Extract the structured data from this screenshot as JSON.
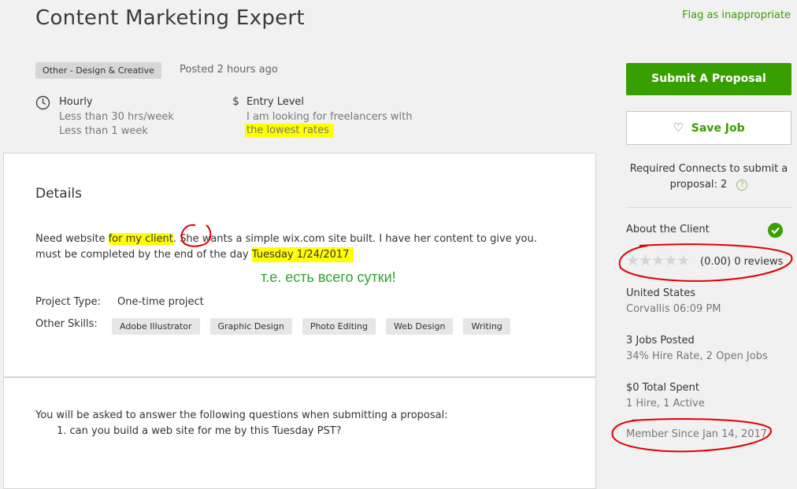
{
  "header": {
    "title": "Content Marketing Expert",
    "flag_label": "Flag as inappropriate"
  },
  "meta": {
    "category": "Other - Design & Creative",
    "posted": "Posted 2 hours ago",
    "hourly_title": "Hourly",
    "hourly_sub1": "Less than 30 hrs/week",
    "hourly_sub2": "Less than 1 week",
    "level_symbol": "$",
    "level_title": "Entry Level",
    "level_sub1": "I am looking for freelancers with",
    "level_sub2": "the lowest rates"
  },
  "details": {
    "heading": "Details",
    "desc_part1": "Need website ",
    "desc_hl1": "for my client",
    "desc_part2": ". She wants a simple wix.com site built. I have her content to give you.",
    "desc_line2": "must be completed by the end of the day ",
    "desc_hl2": "Tuesday 1/24/2017",
    "annotation": "т.е. есть всего сутки!",
    "project_type_label": "Project Type:",
    "project_type_value": "One-time project",
    "skills_label": "Other Skills:",
    "skills": [
      "Adobe Illustrator",
      "Graphic Design",
      "Photo Editing",
      "Web Design",
      "Writing"
    ]
  },
  "questions": {
    "intro": "You will be asked to answer the following questions when submitting a proposal:",
    "q1": "1. can you build a web site for me by this Tuesday PST?"
  },
  "sidebar": {
    "submit_label": "Submit A Proposal",
    "save_label": "Save Job",
    "connects_line1": "Required Connects to submit a",
    "connects_line2": "proposal: 2",
    "about_client": "About the Client",
    "rating": 0,
    "rating_text": "(0.00) 0 reviews",
    "country": "United States",
    "city_time": "Corvallis 06:09 PM",
    "jobs_posted": "3 Jobs Posted",
    "hire_rate": "34% Hire Rate, 2 Open Jobs",
    "total_spent": "$0 Total Spent",
    "hires": "1 Hire, 1 Active",
    "member_since": "Member Since Jan 14, 2017"
  },
  "colors": {
    "accent": "#37a000",
    "highlight": "#ffff00",
    "annotation": "#e00000"
  }
}
